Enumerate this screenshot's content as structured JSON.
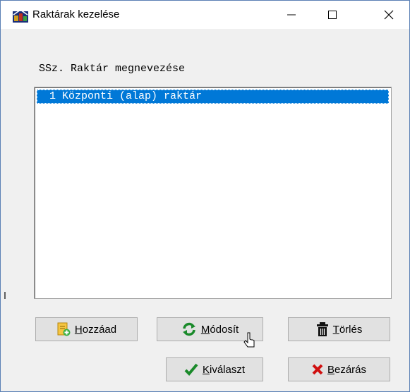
{
  "window": {
    "title": "Raktárak kezelése"
  },
  "titlebar_controls": {
    "minimize": "minimize-icon",
    "maximize": "maximize-icon",
    "close": "close-icon"
  },
  "list": {
    "header": "SSz. Raktár megnevezése",
    "rows": [
      {
        "text": "  1 Központi (alap) raktár",
        "selected": true
      }
    ]
  },
  "buttons": {
    "add": {
      "label": "Hozzáad",
      "icon": "add-document-icon"
    },
    "modify": {
      "label": "Módosít",
      "icon": "refresh-icon"
    },
    "delete": {
      "label": "Törlés",
      "icon": "trash-icon"
    },
    "select": {
      "label": "Kiválaszt",
      "icon": "checkmark-icon"
    },
    "close": {
      "label": "Bezárás",
      "icon": "x-icon"
    }
  },
  "colors": {
    "selection": "#0078d7",
    "button_face": "#e1e1e1",
    "dialog_bg": "#f0f0f0"
  }
}
